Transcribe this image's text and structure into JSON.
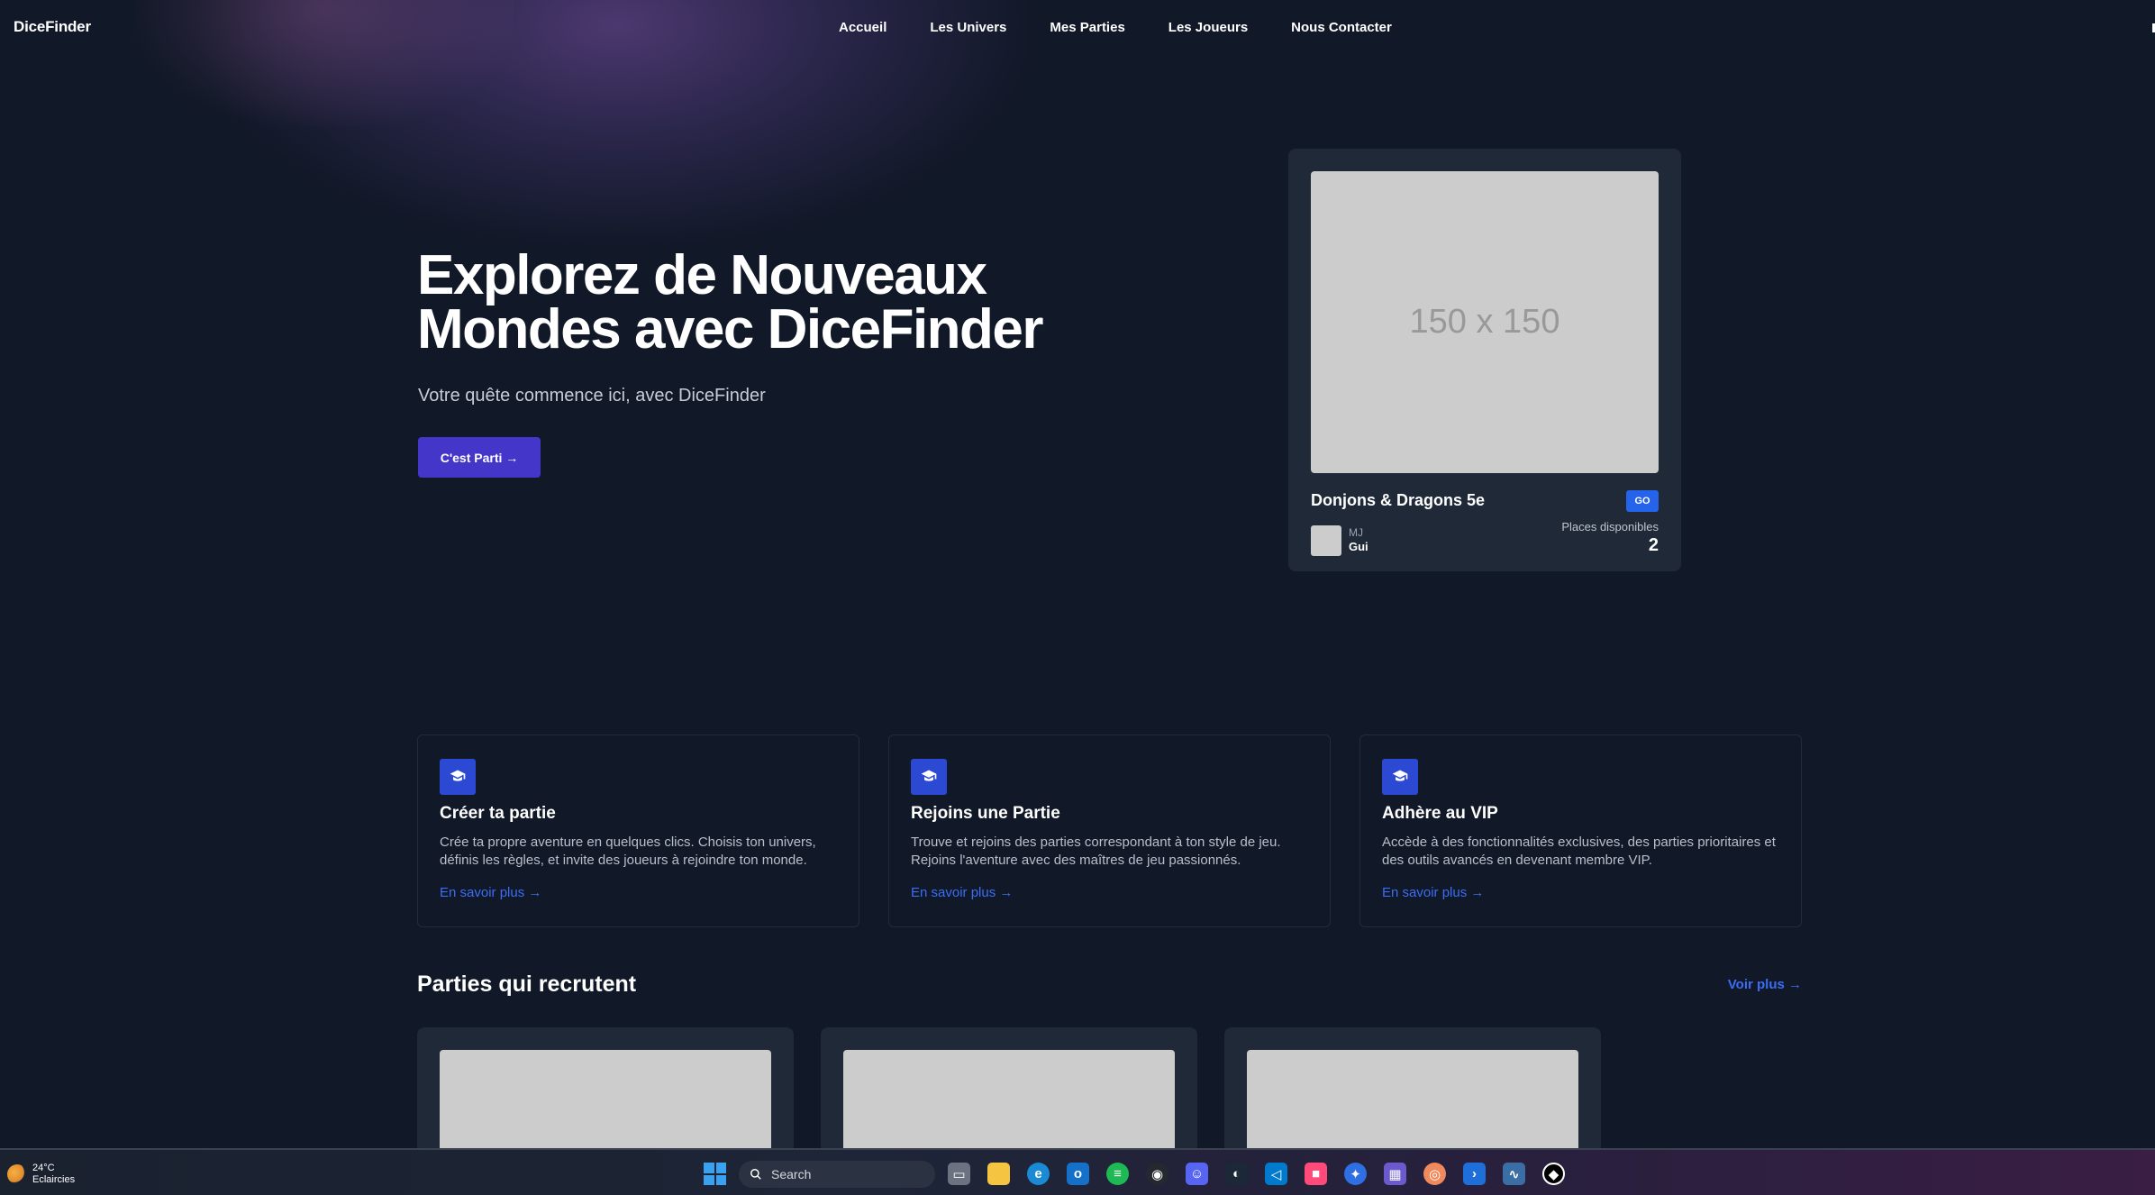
{
  "nav": {
    "brand": "DiceFinder",
    "links": [
      "Accueil",
      "Les Univers",
      "Mes Parties",
      "Les Joueurs",
      "Nous Contacter"
    ]
  },
  "hero": {
    "title_line1": "Explorez de Nouveaux",
    "title_line2": "Mondes avec DiceFinder",
    "subtitle": "Votre quête commence ici, avec DiceFinder",
    "cta_label": "C'est Parti →"
  },
  "hero_card": {
    "image_placeholder": "150 x 150",
    "game_name": "Donjons & Dragons 5e",
    "go_label": "GO",
    "mj_label": "MJ",
    "mj_name": "Gui",
    "places_label": "Places disponibles",
    "places_count": "2"
  },
  "features": [
    {
      "title": "Créer ta partie",
      "description": "Crée ta propre aventure en quelques clics. Choisis ton univers, définis les règles, et invite des joueurs à rejoindre ton monde.",
      "link": "En savoir plus →"
    },
    {
      "title": "Rejoins une Partie",
      "description": "Trouve et rejoins des parties correspondant à ton style de jeu. Rejoins l'aventure avec des maîtres de jeu passionnés.",
      "link": "En savoir plus →"
    },
    {
      "title": "Adhère au VIP",
      "description": "Accède à des fonctionnalités exclusives, des parties prioritaires et des outils avancés en devenant membre VIP.",
      "link": "En savoir plus →"
    }
  ],
  "recruiting": {
    "title": "Parties qui recrutent",
    "more_link": "Voir plus →"
  },
  "taskbar": {
    "temperature": "24°C",
    "weather": "Eclaircies",
    "search_placeholder": "Search",
    "accent_colors": [
      "#3aa0f0",
      "#1db954",
      "#ff4a7a"
    ]
  }
}
